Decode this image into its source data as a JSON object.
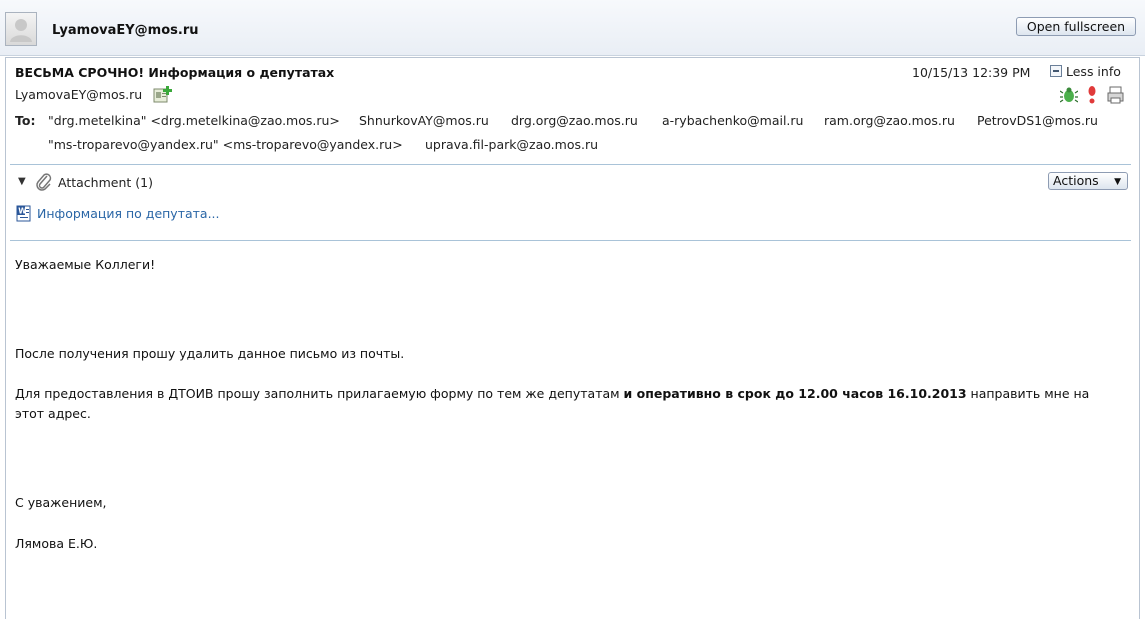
{
  "header": {
    "sender": "LyamovaEY@mos.ru",
    "fullscreen_label": "Open fullscreen"
  },
  "message": {
    "subject": "ВЕСЬМА СРОЧНО! Информация о депутатах",
    "datetime": "10/15/13 12:39 PM",
    "less_info_label": "Less info",
    "from": "LyamovaEY@mos.ru",
    "to_label": "To:",
    "recipients_row1": [
      "\"drg.metelkina\" <drg.metelkina@zao.mos.ru>",
      "ShnurkovAY@mos.ru",
      "drg.org@zao.mos.ru",
      "a-rybachenko@mail.ru",
      "ram.org@zao.mos.ru",
      "PetrovDS1@mos.ru"
    ],
    "recipients_row2": [
      "\"ms-troparevo@yandex.ru\" <ms-troparevo@yandex.ru>",
      "uprava.fil-park@zao.mos.ru"
    ]
  },
  "attachments": {
    "label": "Attachment (1)",
    "actions_label": "Actions",
    "file_name": "Информация по депутата..."
  },
  "body": {
    "greeting": "Уважаемые Коллеги!",
    "line1": "После получения прошу удалить данное письмо из почты.",
    "line2_start": "Для предоставления в ДТОИВ прошу заполнить прилагаемую форму по тем же депутатам ",
    "line2_bold": "и оперативно в срок до 12.00 часов 16.10.2013",
    "line2_end": " направить мне на этот адрес.",
    "closing": "С уважением,",
    "signature": "Лямова Е.Ю."
  },
  "colors": {
    "accent_link": "#2a66a6",
    "separator": "#a9c3d8"
  },
  "icons": [
    "avatar-placeholder-icon",
    "add-contact-icon",
    "bug-icon",
    "priority-icon",
    "print-icon",
    "paperclip-icon",
    "word-document-icon"
  ]
}
